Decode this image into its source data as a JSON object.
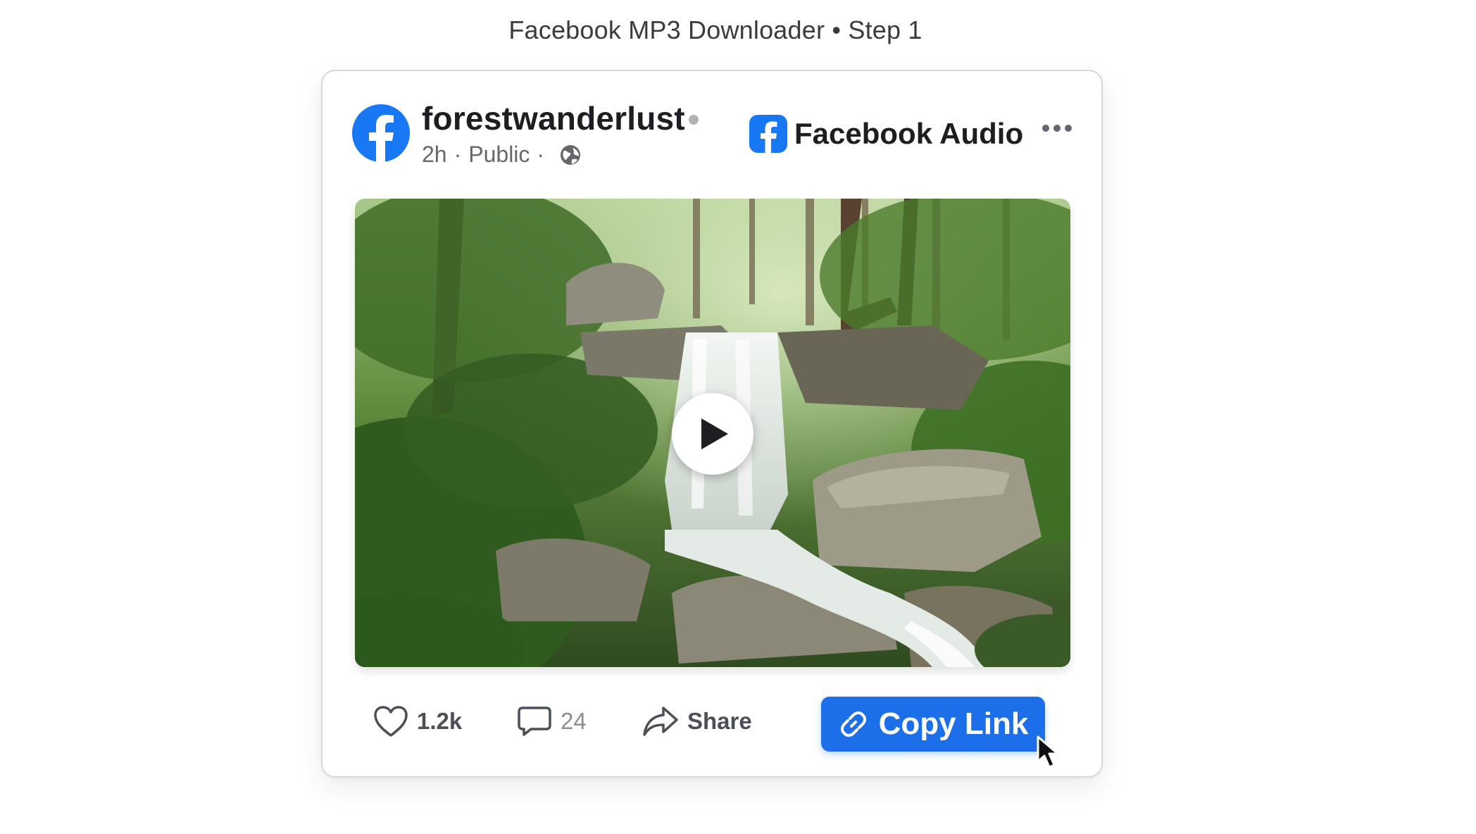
{
  "page": {
    "title": "Facebook MP3 Downloader • Step 1"
  },
  "post": {
    "username": "forestwanderlust",
    "time": "2h",
    "visibility": "Public",
    "brand_label": "Facebook Audio"
  },
  "actions": {
    "likes": "1.2k",
    "comments": "24",
    "share_label": "Share",
    "copy_link_label": "Copy Link"
  },
  "colors": {
    "accent": "#1877f2",
    "button": "#1c6fe8"
  },
  "icons": [
    "facebook-logo-icon",
    "globe-icon",
    "more-icon",
    "play-icon",
    "heart-icon",
    "comment-icon",
    "share-icon",
    "link-icon",
    "cursor-icon"
  ]
}
